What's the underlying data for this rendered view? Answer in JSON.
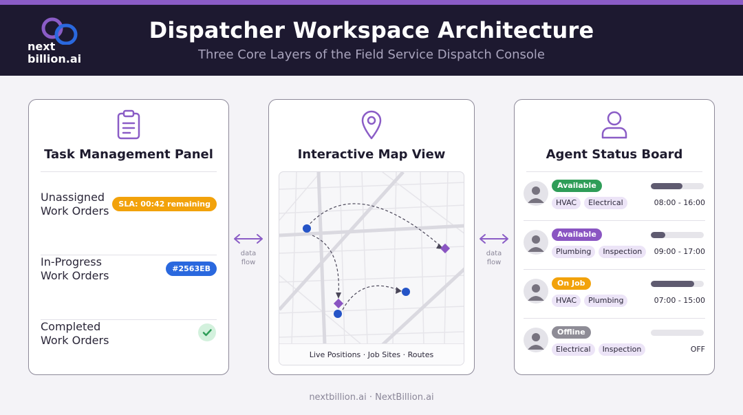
{
  "header": {
    "logo_line1": "next",
    "logo_line2": "billion.ai",
    "title": "Dispatcher Workspace Architecture",
    "subtitle": "Three Core Layers of the Field Service Dispatch Console"
  },
  "colors": {
    "header_bg": "#1d1930",
    "accent": "#8a5cc6",
    "sla_orange": "#f2a20b",
    "blue_badge": "#2a68de",
    "green": "#2f9d58",
    "gray": "#8e8c96"
  },
  "task_panel": {
    "icon": "clipboard-icon",
    "title": "Task Management Panel",
    "rows": [
      {
        "label": "Unassigned Work Orders",
        "badge": "SLA: 00:42 remaining"
      },
      {
        "label": "In-Progress Work Orders",
        "badge": "#2563EB"
      },
      {
        "label": "Completed Work Orders",
        "icon": "check-icon"
      }
    ]
  },
  "flow": {
    "left_label": "data\nflow",
    "right_label": "data\nflow"
  },
  "map_panel": {
    "icon": "map-pin-icon",
    "title": "Interactive Map View",
    "caption": "Live Positions · Job Sites · Routes"
  },
  "agent_board": {
    "icon": "person-icon",
    "title": "Agent Status Board",
    "agents": [
      {
        "status": "Available",
        "skills": [
          "HVAC",
          "Electrical"
        ],
        "hours": "08:00 - 16:00",
        "load": 0.6
      },
      {
        "status": "Available",
        "skills": [
          "Plumbing",
          "Inspection"
        ],
        "hours": "09:00 - 17:00",
        "load": 0.27
      },
      {
        "status": "On Job",
        "skills": [
          "HVAC",
          "Plumbing"
        ],
        "hours": "07:00 - 15:00",
        "load": 0.82
      },
      {
        "status": "Offline",
        "skills": [
          "Electrical",
          "Inspection"
        ],
        "hours": "OFF",
        "load": 0
      }
    ]
  },
  "footer": "nextbillion.ai · NextBillion.ai"
}
